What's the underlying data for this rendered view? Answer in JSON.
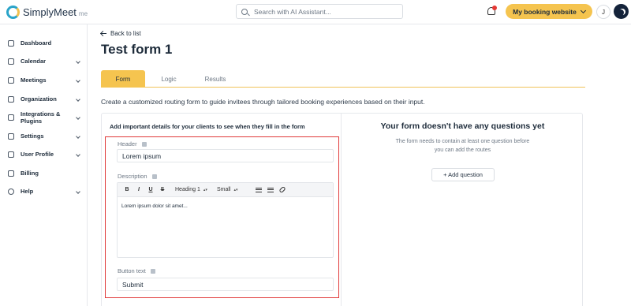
{
  "app": {
    "logo_text": "SimplyMeet",
    "logo_suffix": "me"
  },
  "topbar": {
    "search_placeholder": "Search with AI Assistant...",
    "booking_button": "My booking website",
    "avatar_initial": "J"
  },
  "sidebar": {
    "items": [
      {
        "label": "Dashboard"
      },
      {
        "label": "Calendar"
      },
      {
        "label": "Meetings"
      },
      {
        "label": "Organization"
      },
      {
        "label": "Integrations & Plugins"
      },
      {
        "label": "Settings"
      },
      {
        "label": "User Profile"
      },
      {
        "label": "Billing"
      },
      {
        "label": "Help"
      }
    ]
  },
  "main": {
    "back_label": "Back to list",
    "title": "Test form 1",
    "tabs": [
      {
        "label": "Form"
      },
      {
        "label": "Logic"
      },
      {
        "label": "Results"
      }
    ],
    "intro": "Create a customized routing form to guide invitees through tailored booking experiences based on their input."
  },
  "form": {
    "heading": "Add important details for your clients to see when they fill in the form",
    "header_label": "Header",
    "header_value": "Lorem ipsum",
    "description_label": "Description",
    "toolbar": {
      "bold": "B",
      "italic": "I",
      "underline": "U",
      "strike": "S",
      "heading_select": "Heading 1",
      "size_select": "Small",
      "select_arrow": "▴▾"
    },
    "description_text": "Lorem ipsum dolor sit amet...",
    "button_text_label": "Button text",
    "button_text_value": "Submit"
  },
  "empty_state": {
    "title": "Your form doesn't have any questions yet",
    "line1": "The form needs to contain at least one question before",
    "line2": "you can add the routes",
    "add_button": "+ Add question"
  }
}
